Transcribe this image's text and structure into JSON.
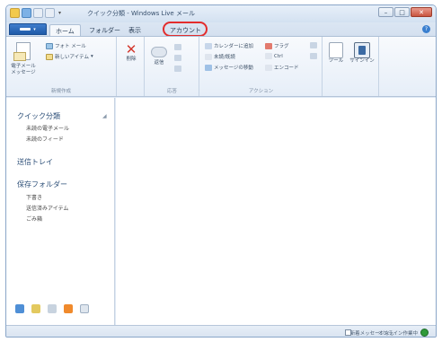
{
  "window": {
    "title": "クイック分類 - Windows Live メール"
  },
  "tabs": [
    {
      "label": "ホーム",
      "active": true
    },
    {
      "label": "フォルダー",
      "active": false
    },
    {
      "label": "表示",
      "active": false
    },
    {
      "label": "アカウント",
      "active": false,
      "highlighted": true
    }
  ],
  "ribbon": {
    "new_group": {
      "label": "新規作成",
      "email_message": "電子メール\nメッセージ",
      "photo_mail": "フォト メール",
      "new_items": "新しいアイテム"
    },
    "delete_group": {
      "label": "",
      "delete": "削除"
    },
    "reply_group": {
      "label": "応答",
      "reply": "返信"
    },
    "actions_group": {
      "label": "アクション",
      "items": [
        "カレンダーに追加",
        "フラグ",
        "未読/既読",
        "Ctrl",
        "メッセージの移動",
        "エンコード"
      ]
    },
    "tools_group": {
      "tools": "ツール",
      "signin": "サインイン"
    }
  },
  "nav": {
    "sections": [
      {
        "label": "クイック分類",
        "items": [
          "未読の電子メール",
          "未読のフィード"
        ]
      },
      {
        "label": "送信トレイ",
        "items": []
      },
      {
        "label": "保存フォルダー",
        "items": [
          "下書き",
          "送信済みアイテム",
          "ごみ箱"
        ]
      }
    ]
  },
  "statusbar": {
    "message": "新着メッセージなし",
    "work_offline": "オンライン作業中"
  },
  "colors": {
    "accent": "#1f5aa8",
    "highlight_ring": "#e32d2d",
    "online": "#2f9a3a"
  },
  "icons": {
    "bottom_nav": [
      "mail-icon",
      "calendar-icon",
      "contacts-icon",
      "feeds-icon",
      "newsgroups-icon"
    ]
  }
}
